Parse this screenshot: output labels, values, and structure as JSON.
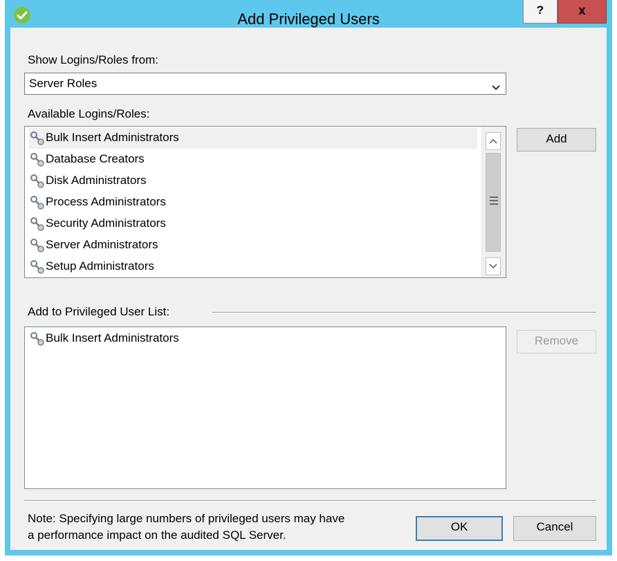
{
  "window": {
    "title": "Add Privileged Users",
    "help_label": "?",
    "close_label": "x"
  },
  "colors": {
    "titlebar": "#5ec8ec",
    "close": "#c75050",
    "client": "#f0f0f0",
    "app_icon": "#7cc242"
  },
  "source": {
    "label": "Show Logins/Roles from:",
    "selected": "Server Roles"
  },
  "available": {
    "label": "Available Logins/Roles:",
    "items": [
      {
        "label": "Bulk Insert Administrators",
        "icon": "role-key-icon"
      },
      {
        "label": "Database Creators",
        "icon": "role-key-icon"
      },
      {
        "label": "Disk Administrators",
        "icon": "role-key-icon"
      },
      {
        "label": "Process Administrators",
        "icon": "role-key-icon"
      },
      {
        "label": "Security Administrators",
        "icon": "role-key-icon"
      },
      {
        "label": "Server Administrators",
        "icon": "role-key-icon"
      },
      {
        "label": "Setup Administrators",
        "icon": "role-key-icon"
      }
    ]
  },
  "privileged": {
    "label": "Add to Privileged User List:",
    "items": [
      {
        "label": "Bulk Insert Administrators",
        "icon": "role-key-icon"
      }
    ]
  },
  "buttons": {
    "add": "Add",
    "remove": "Remove",
    "ok": "OK",
    "cancel": "Cancel"
  },
  "note": {
    "line1": "Note: Specifying large numbers of privileged users may have",
    "line2": "a performance impact on the audited SQL Server."
  }
}
